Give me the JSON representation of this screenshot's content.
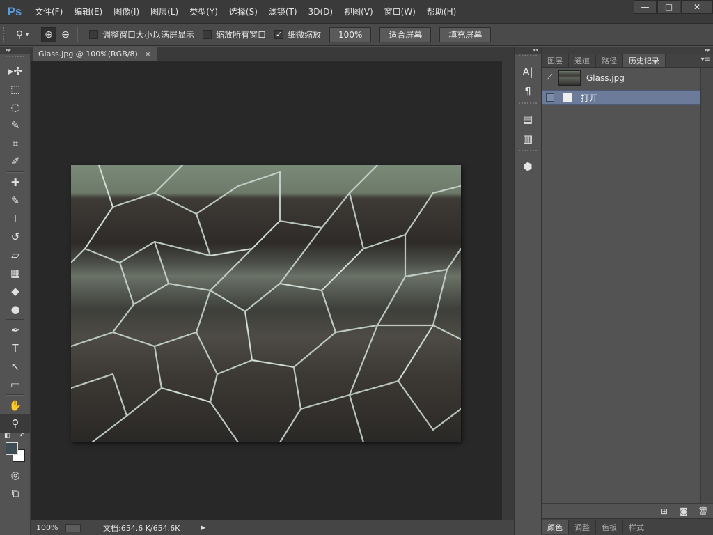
{
  "app": {
    "logo": "Ps"
  },
  "menu": [
    "文件(F)",
    "编辑(E)",
    "图像(I)",
    "图层(L)",
    "类型(Y)",
    "选择(S)",
    "滤镜(T)",
    "3D(D)",
    "视图(V)",
    "窗口(W)",
    "帮助(H)"
  ],
  "window_controls": {
    "minimize": "—",
    "maximize": "□",
    "close": "✕"
  },
  "options": {
    "tool_icon": "zoom-icon",
    "zoom_in": "⊕",
    "zoom_out": "⊖",
    "chk_resize": {
      "label": "调整窗口大小以满屏显示",
      "checked": false
    },
    "chk_all": {
      "label": "缩放所有窗口",
      "checked": false
    },
    "chk_scrubby": {
      "label": "细微缩放",
      "checked": true,
      "mark": "✓"
    },
    "btn_100": "100%",
    "btn_fit": "适合屏幕",
    "btn_fill": "填充屏幕"
  },
  "tools": {
    "move": "▸✣",
    "marquee": "⬚",
    "lasso": "◌",
    "quick": "✎",
    "crop": "⌗",
    "eyedropper": "✐",
    "heal": "✚",
    "brush": "✎",
    "stamp": "⊥",
    "history_brush": "↺",
    "eraser": "▱",
    "gradient": "▦",
    "blur": "◆",
    "dodge": "●",
    "pen": "✒",
    "type": "T",
    "path": "↖",
    "shape": "▭",
    "hand": "✋",
    "zoom": "⚲",
    "quickmask": "◎",
    "screen": "⧉"
  },
  "document": {
    "tab_title": "Glass.jpg @ 100%(RGB/8)",
    "tab_close": "×"
  },
  "status": {
    "zoom": "100%",
    "doc": "文档:654.6 K/654.6K",
    "arrow": "▶"
  },
  "middock": {
    "char": "A|",
    "para": "¶",
    "notes1": "▤",
    "notes2": "▥",
    "cube": "⬢",
    "collapse": "◂◂"
  },
  "right_panel": {
    "collapse": "▸▸",
    "tabs": [
      "图层",
      "通道",
      "路径",
      "历史记录"
    ],
    "menu_icon": "▾≡",
    "snapshot": {
      "brush_icon": "⟋",
      "name": "Glass.jpg"
    },
    "state": {
      "name": "打开"
    },
    "footer": {
      "new_doc": "⊞",
      "snapshot": "◙",
      "trash": "🗑"
    },
    "bottom_tabs": [
      "颜色",
      "调整",
      "色板",
      "样式"
    ]
  }
}
